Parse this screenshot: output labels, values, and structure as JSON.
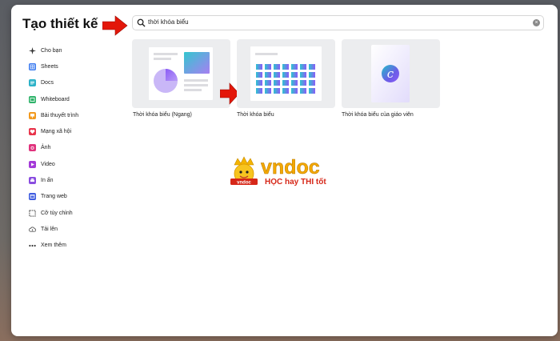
{
  "dialog": {
    "title": "Tạo thiết kế"
  },
  "search": {
    "value": "thời khóa biểu",
    "clear_icon": "×"
  },
  "sidebar": {
    "items": [
      {
        "label": "Cho bạn",
        "icon": "sparkle-icon",
        "color": "#333333"
      },
      {
        "label": "Sheets",
        "icon": "sheets-icon",
        "color": "#3f7df0"
      },
      {
        "label": "Docs",
        "icon": "docs-icon",
        "color": "#2db2c8"
      },
      {
        "label": "Whiteboard",
        "icon": "whiteboard-icon",
        "color": "#2fb36a"
      },
      {
        "label": "Bài thuyết trình",
        "icon": "presentation-icon",
        "color": "#f29a1f"
      },
      {
        "label": "Mạng xã hội",
        "icon": "heart-icon",
        "color": "#e8334a"
      },
      {
        "label": "Ảnh",
        "icon": "photo-icon",
        "color": "#e0337d"
      },
      {
        "label": "Video",
        "icon": "video-icon",
        "color": "#a43ad8"
      },
      {
        "label": "In ấn",
        "icon": "print-icon",
        "color": "#8a4ee0"
      },
      {
        "label": "Trang web",
        "icon": "web-icon",
        "color": "#3f5de0"
      },
      {
        "label": "Cỡ tùy chỉnh",
        "icon": "custom-size-icon",
        "color": "#333333"
      },
      {
        "label": "Tải lên",
        "icon": "upload-icon",
        "color": "#333333"
      },
      {
        "label": "Xem thêm",
        "icon": "more-icon",
        "color": "#333333"
      }
    ]
  },
  "results": [
    {
      "label": "Thời khóa biểu (Ngang)",
      "thumbnail": "landscape-timetable"
    },
    {
      "label": "Thời khóa biểu",
      "thumbnail": "timetable"
    },
    {
      "label": "Thời khóa biểu của giáo viên",
      "thumbnail": "teacher-timetable"
    }
  ],
  "watermark": {
    "brand": "vndoc",
    "tagline": "HỌC hay THI tốt",
    "badge": "vndoc"
  },
  "colors": {
    "accent_red": "#e3170a",
    "purple": "#8b5cf6",
    "teal": "#22c0c8"
  }
}
